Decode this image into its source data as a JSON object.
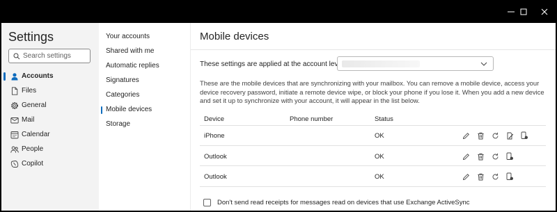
{
  "window_controls": {
    "minimize_icon": "minimize-icon",
    "maximize_icon": "maximize-icon",
    "close_icon": "close-icon"
  },
  "settings": {
    "title": "Settings",
    "search_placeholder": "Search settings",
    "nav": [
      {
        "label": "Accounts",
        "icon": "person-icon",
        "active": true
      },
      {
        "label": "Files",
        "icon": "file-icon"
      },
      {
        "label": "General",
        "icon": "gear-icon"
      },
      {
        "label": "Mail",
        "icon": "mail-icon"
      },
      {
        "label": "Calendar",
        "icon": "calendar-icon"
      },
      {
        "label": "People",
        "icon": "people-icon"
      },
      {
        "label": "Copilot",
        "icon": "copilot-icon"
      }
    ]
  },
  "subnav": {
    "items": [
      {
        "label": "Your accounts"
      },
      {
        "label": "Shared with me"
      },
      {
        "label": "Automatic replies"
      },
      {
        "label": "Signatures"
      },
      {
        "label": "Categories"
      },
      {
        "label": "Mobile devices",
        "active": true
      },
      {
        "label": "Storage"
      }
    ]
  },
  "main": {
    "title": "Mobile devices",
    "account_level_label": "These settings are applied at the account level:",
    "account_dropdown_value": "",
    "description": "These are the mobile devices that are synchronizing with your mailbox. You can remove a mobile device, access your device recovery password, initiate a remote device wipe, or block your phone if you lose it. When you add a new device and set it up to synchronize with your account, it will appear in the list below.",
    "table": {
      "headers": {
        "device": "Device",
        "phone": "Phone number",
        "status": "Status"
      },
      "rows": [
        {
          "device": "iPhone",
          "phone": "",
          "status": "OK",
          "actions": [
            "edit-icon",
            "delete-icon",
            "refresh-icon",
            "wipe-icon",
            "block-device-icon"
          ]
        },
        {
          "device": "Outlook",
          "phone": "",
          "status": "OK",
          "actions": [
            "edit-icon",
            "delete-icon",
            "refresh-icon",
            "block-device-icon"
          ]
        },
        {
          "device": "Outlook",
          "phone": "",
          "status": "OK",
          "actions": [
            "edit-icon",
            "delete-icon",
            "refresh-icon",
            "block-device-icon"
          ]
        }
      ]
    },
    "read_receipts_label": "Don't send read receipts for messages read on devices that use Exchange ActiveSync",
    "read_receipts_checked": false
  },
  "colors": {
    "accent": "#0f6cbd",
    "nav_bg": "#f3f3f3",
    "titlebar": "#000000"
  }
}
